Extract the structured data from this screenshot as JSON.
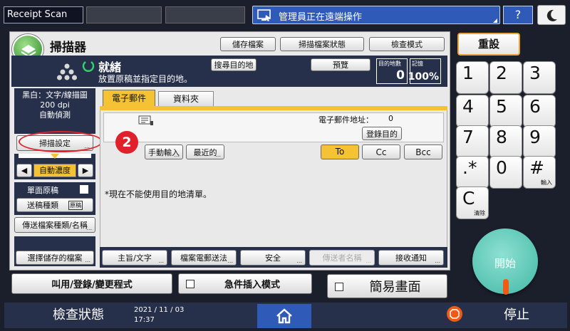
{
  "topbar": {
    "app_title": "Receipt Scan",
    "remote_message": "管理員正在遠端操作",
    "help_label": "?"
  },
  "header": {
    "title": "掃描器",
    "buttons": [
      "儲存檔案",
      "掃描檔案狀態",
      "檢查模式"
    ]
  },
  "status": {
    "state": "就緒",
    "message": "放置原稿並指定目的地。",
    "search_dest_label": "搜尋目的地",
    "preview_label": "預覽",
    "dest_count_label": "目的地數",
    "dest_count": "0",
    "memory_label": "記憶",
    "memory_value": "100%"
  },
  "left_panel": {
    "mode_line1": "黑白：文字/線描圖",
    "mode_line2": "200 dpi",
    "mode_line3": "自動偵測",
    "scan_settings_label": "掃描設定",
    "density_label": "自動濃度",
    "single_sided_label": "單面原稿",
    "send_type_label": "送稿種類",
    "send_type_badge": "原稿",
    "file_type_label": "傳送檔案種類/名稱",
    "select_stored_label": "選擇儲存的檔案"
  },
  "tabs": [
    "電子郵件",
    "資料夾"
  ],
  "email_panel": {
    "address_label": "電子郵件地址：",
    "address_count": "0",
    "register_dest_label": "登錄目的",
    "manual_input_label": "手動輸入",
    "recent_label": "最近的",
    "to_label": "To",
    "cc_label": "Cc",
    "bcc_label": "Bcc",
    "notice": "*現在不能使用目的地清單。"
  },
  "annotation": {
    "step_number": "2"
  },
  "bottom_buttons": [
    "主旨/文字",
    "檔案電郵送法",
    "安全",
    "傳送者名稱",
    "接收通知"
  ],
  "program_bar": {
    "program_label": "叫用/登錄/變更程式",
    "interrupt_label": "急件插入模式",
    "simple_screen_label": "簡易畫面"
  },
  "keypad": {
    "reset_label": "重設",
    "keys": [
      "1",
      "2",
      "3",
      "4",
      "5",
      "6",
      "7",
      "8",
      "9",
      ".*",
      "0",
      "#"
    ],
    "hash_sub": "輸入",
    "clear_label": "C",
    "clear_sub": "清除",
    "start_label": "開始"
  },
  "footer": {
    "check_status_label": "檢查狀態",
    "date": "2021 / 11 / 03",
    "time": "17:37",
    "stop_label": "停止"
  },
  "colors": {
    "background": "#1b1f2b",
    "panel": "#e9e9e9",
    "active_tab": "#f4c233",
    "annotation_red": "#e0202a",
    "reset_border": "#e9a33a",
    "start_button": "#6fcfbf"
  },
  "icons": {
    "remote": "remote-monitor-icon",
    "moon": "moon-icon",
    "home": "home-icon",
    "stop": "stop-icon"
  }
}
